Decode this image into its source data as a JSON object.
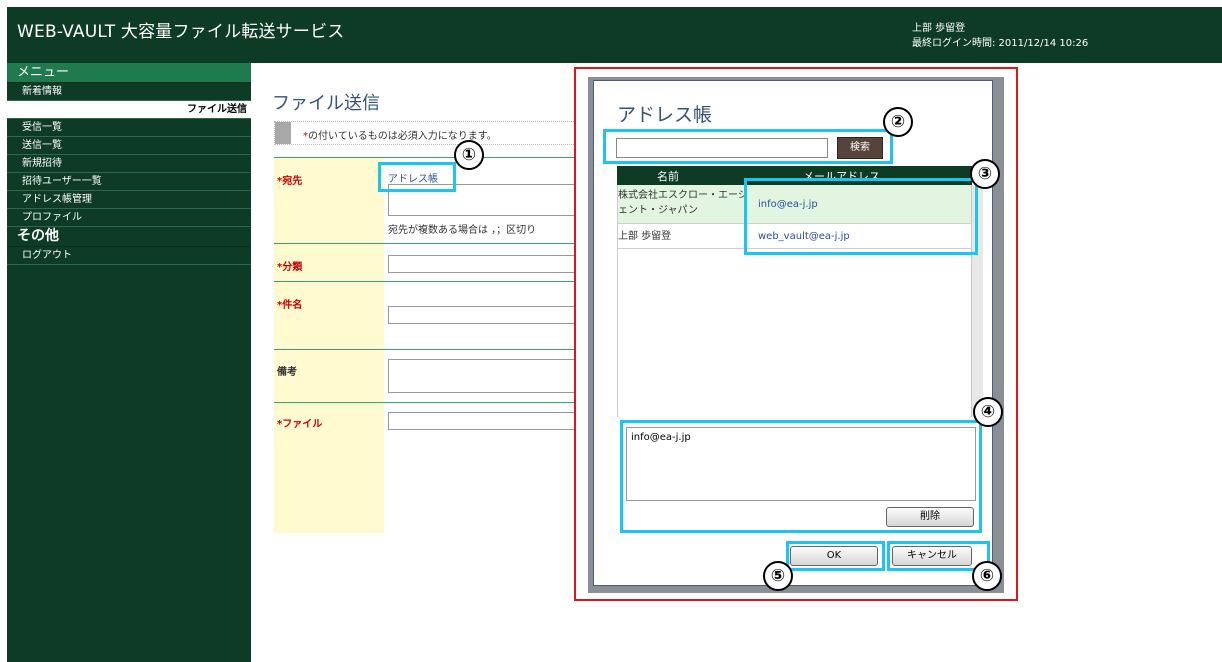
{
  "header": {
    "title": "WEB-VAULT 大容量ファイル転送サービス",
    "user_name": "上部 歩留登",
    "last_login": "最終ログイン時間: 2011/12/14 10:26"
  },
  "sidebar": {
    "menu_heading": "メニュー",
    "items": [
      {
        "label": "新着情報"
      },
      {
        "label": "ファイル送信"
      },
      {
        "label": "受信一覧"
      },
      {
        "label": "送信一覧"
      },
      {
        "label": "新規招待"
      },
      {
        "label": "招待ユーザー一覧"
      },
      {
        "label": "アドレス帳管理"
      },
      {
        "label": "プロファイル"
      }
    ],
    "other_heading": "その他",
    "other_items": [
      {
        "label": "ログアウト"
      }
    ]
  },
  "form": {
    "title": "ファイル送信",
    "notice_mark": "*",
    "notice": "の付いているものは必須入力になります。",
    "to_label": "*宛先",
    "address_book_link": "アドレス帳",
    "to_hint": "宛先が複数ある場合は ，；区切り",
    "category_label": "*分類",
    "subject_label": "*件名",
    "remarks_label": "備考",
    "file_label": "*ファイル"
  },
  "dialog": {
    "title": "アドレス帳",
    "search_value": "",
    "search_button": "検索",
    "col_name": "名前",
    "col_email": "メールアドレス",
    "rows": [
      {
        "name": "株式会社エスクロー・エージェント・ジャパン",
        "email": "info@ea-j.jp"
      },
      {
        "name": "上部 歩留登",
        "email": "web_vault@ea-j.jp"
      }
    ],
    "selected_email": "info@ea-j.jp",
    "delete_button": "削除",
    "ok_button": "OK",
    "cancel_button": "キャンセル"
  },
  "callouts": [
    "①",
    "②",
    "③",
    "④",
    "⑤",
    "⑥"
  ],
  "colors": {
    "header_bg": "#0d3b26",
    "menu_head_bg": "#1f7a4d",
    "required_label_bg": "#fffad0",
    "frame_red": "#e0151b",
    "callout_cyan": "#1cc4f2"
  }
}
